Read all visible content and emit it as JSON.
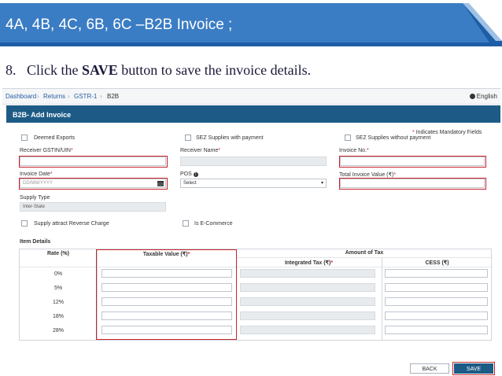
{
  "slide": {
    "title": "4A, 4B, 4C, 6B, 6C –B2B Invoice ;",
    "step_number": "8.",
    "instruction_pre": "Click the ",
    "instruction_bold": "SAVE",
    "instruction_post": " button to save the invoice details."
  },
  "breadcrumb": [
    "Dashboard",
    "Returns",
    "GSTR-1",
    "B2B"
  ],
  "language": "English",
  "panel": {
    "title": "B2B- Add Invoice"
  },
  "mandatory_note": "Indicates Mandatory Fields",
  "checkboxes": {
    "deemed_exports": "Deemed Exports",
    "sez_with_payment": "SEZ Supplies with payment",
    "sez_without_payment": "SEZ Supplies without payment",
    "reverse_charge": "Supply attract Reverse Charge",
    "ecommerce": "Is E-Commerce"
  },
  "fields": {
    "receiver_gstin": {
      "label": "Receiver GSTIN/UIN",
      "value": ""
    },
    "receiver_name": {
      "label": "Receiver Name",
      "value": ""
    },
    "invoice_no": {
      "label": "Invoice No.",
      "value": ""
    },
    "invoice_date": {
      "label": "Invoice Date",
      "placeholder": "DD/MM/YYYY"
    },
    "pos": {
      "label": "POS",
      "selected": "Select"
    },
    "total_invoice_value": {
      "label": "Total Invoice Value (₹)",
      "value": ""
    },
    "supply_type": {
      "label": "Supply Type",
      "value": "Inter-State"
    }
  },
  "item_details": {
    "title": "Item Details",
    "headers": {
      "rate": "Rate (%)",
      "taxable_value": "Taxable Value (₹)",
      "amount_of_tax": "Amount of Tax",
      "integrated_tax": "Integrated Tax (₹)",
      "cess": "CESS (₹)"
    },
    "rates": [
      "0%",
      "5%",
      "12%",
      "18%",
      "28%"
    ]
  },
  "buttons": {
    "back": "BACK",
    "save": "SAVE"
  },
  "colors": {
    "banner": "#2e74b5",
    "panel_header": "#1d5b86",
    "highlight": "#c4242b",
    "required": "#d9232d"
  }
}
